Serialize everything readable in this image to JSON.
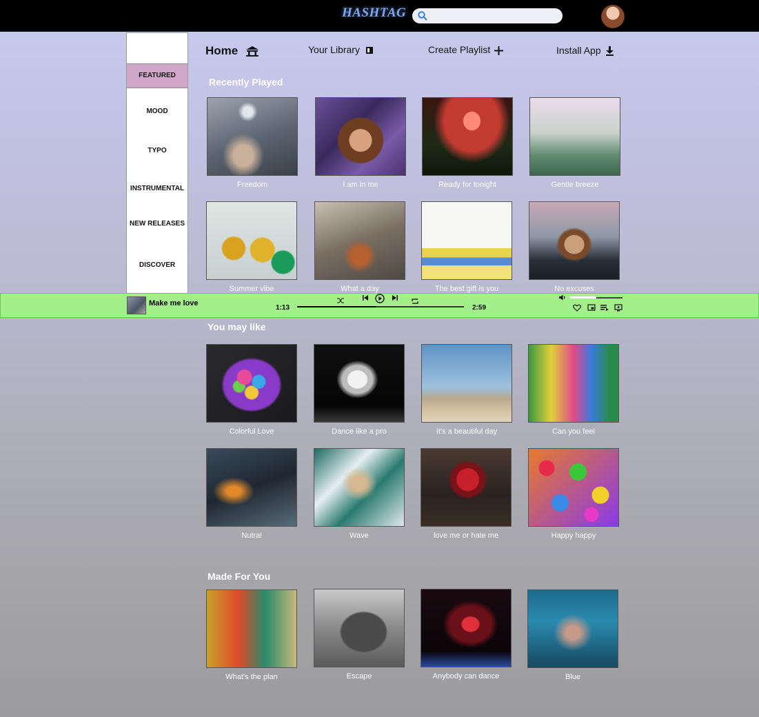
{
  "topbar": {
    "logo": "HASHTAG",
    "search_placeholder": ""
  },
  "sidebar": {
    "items": [
      "FEATURED",
      "MOOD",
      "TYPO",
      "INSTRUMENTAL",
      "NEW RELEASES",
      "DISCOVER"
    ]
  },
  "nav": {
    "home": "Home",
    "library": "Your Library",
    "create_playlist": "Create Playlist",
    "install_app": "Install App"
  },
  "sections": {
    "recently_played": {
      "title": "Recently Played",
      "cards": [
        "Freedom",
        "I am in me",
        "Ready for tonight",
        "Gentle breeze",
        "Summer vibe",
        "What a day",
        "The best gift is you",
        "No excuses"
      ]
    },
    "you_may_like": {
      "title": "You may like",
      "cards": [
        "Colorful Love",
        "Dance like a pro",
        "It's a beautiful day",
        "Can you feel",
        "Nutral",
        "Wave",
        "love me or hate me",
        "Happy happy"
      ]
    },
    "made_for_you": {
      "title": "Made For You",
      "cards": [
        "What's the plan",
        "Escape",
        "Anybody can dance",
        "Blue"
      ]
    }
  },
  "player": {
    "title": "Make me love",
    "elapsed": "1:13",
    "duration": "2:59",
    "progress": 0.47,
    "volume": 0.5
  },
  "colors": {
    "accent_green": "#a3ef8a",
    "featured_pink": "#cfa8c9",
    "logo_blue": "#7ea6e6"
  }
}
